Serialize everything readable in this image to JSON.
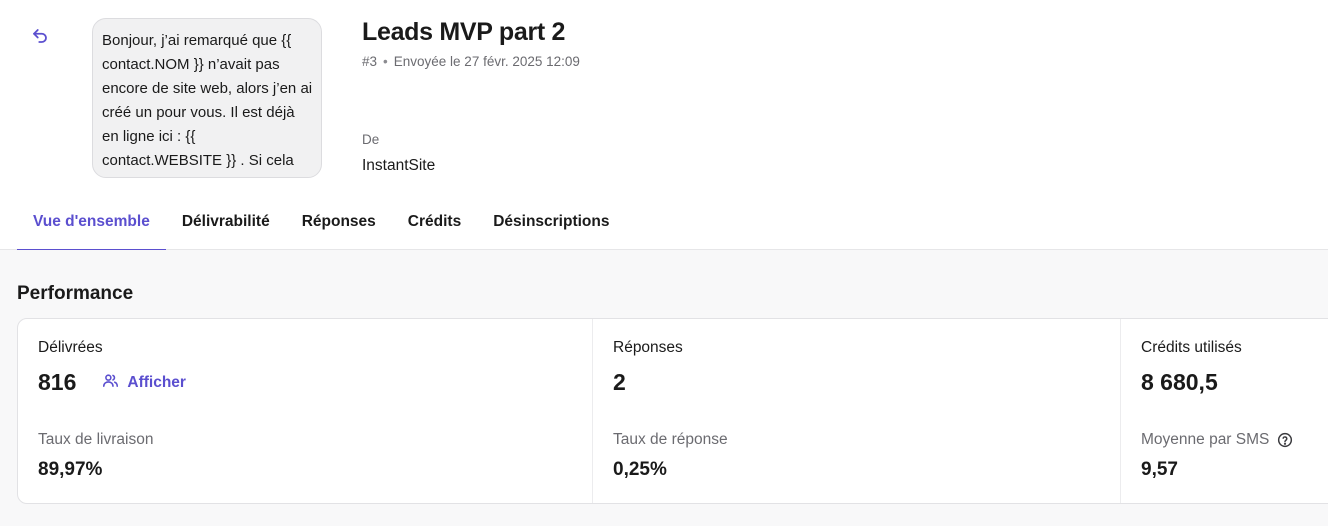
{
  "header": {
    "message_preview": "Bonjour, j’ai remarqué que {{ contact.NOM }} n’avait pas encore de site web, alors j’en ai créé un pour vous. Il est déjà en ligne ici : {{ contact.WEBSITE }} . Si cela vous plaît...",
    "campaign_title": "Leads MVP part 2",
    "campaign_number": "#3",
    "sent_info": "Envoyée le 27 févr. 2025 12:09",
    "from_label": "De",
    "from_value": "InstantSite",
    "back_icon": "undo-arrow-icon"
  },
  "tabs": [
    {
      "label": "Vue d'ensemble",
      "active": true
    },
    {
      "label": "Délivrabilité",
      "active": false
    },
    {
      "label": "Réponses",
      "active": false
    },
    {
      "label": "Crédits",
      "active": false
    },
    {
      "label": "Désinscriptions",
      "active": false
    }
  ],
  "performance": {
    "title": "Performance",
    "delivered": {
      "label": "Délivrées",
      "value": "816",
      "show_label": "Afficher",
      "show_icon": "users-icon",
      "rate_label": "Taux de livraison",
      "rate_value": "89,97%"
    },
    "replies": {
      "label": "Réponses",
      "value": "2",
      "rate_label": "Taux de réponse",
      "rate_value": "0,25%"
    },
    "credits": {
      "label": "Crédits utilisés",
      "value": "8 680,5",
      "avg_label": "Moyenne par SMS",
      "avg_value": "9,57",
      "help_icon": "help-circle-icon"
    }
  },
  "colors": {
    "accent": "#5b4fcf",
    "muted_text": "#6b6b70",
    "content_bg": "#f8f8f9"
  }
}
